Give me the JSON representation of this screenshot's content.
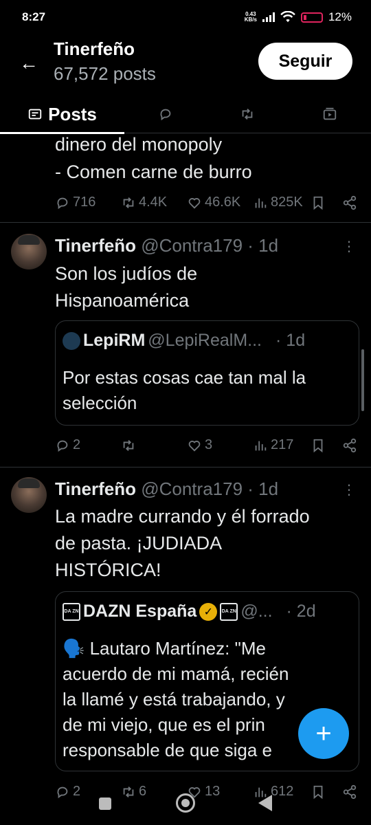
{
  "status_bar": {
    "time": "8:27",
    "net_speed_value": "0.43",
    "net_speed_unit": "KB/s",
    "battery": "12%"
  },
  "header": {
    "name": "Tinerfeño",
    "posts_count": "67,572 posts",
    "follow_label": "Seguir"
  },
  "tabs": {
    "posts_label": "Posts"
  },
  "prev_tweet": {
    "line1": "dinero del monopoly",
    "line2": "- Comen carne de burro",
    "replies": "716",
    "reposts": "4.4K",
    "likes": "46.6K",
    "views": "825K"
  },
  "tweet1": {
    "name": "Tinerfeño",
    "handle": "@Contra179",
    "time": "· 1d",
    "text_line1": "Son los judíos de",
    "text_line2": "Hispanoamérica",
    "quote": {
      "name": "LepiRM",
      "handle": "@LepiRealM...",
      "time": "· 1d",
      "line1": "Por estas cosas cae tan mal la",
      "line2": "selección"
    },
    "replies": "2",
    "reposts": "",
    "likes": "3",
    "views": "217"
  },
  "tweet2": {
    "name": "Tinerfeño",
    "handle": "@Contra179",
    "time": "· 1d",
    "text_line1": "La madre currando y él forrado",
    "text_line2": "de pasta. ¡JUDIADA",
    "text_line3": "HISTÓRICA!",
    "quote": {
      "name": "DAZN España",
      "handle": "@...",
      "time": "· 2d",
      "logo_text": "DA ZN",
      "line1": "🗣️ Lautaro Martínez: \"Me",
      "line2": "acuerdo de mi mamá, recién",
      "line3": "la llamé y está trabajando, y",
      "line4": "de mi viejo, que es el prin",
      "line5": "responsable de que siga e"
    },
    "replies": "2",
    "reposts": "6",
    "likes": "13",
    "views": "612"
  },
  "fab": {
    "label": "+"
  },
  "colors": {
    "accent": "#1d9bf0",
    "verified": "#e8b008",
    "muted": "#71767b"
  }
}
